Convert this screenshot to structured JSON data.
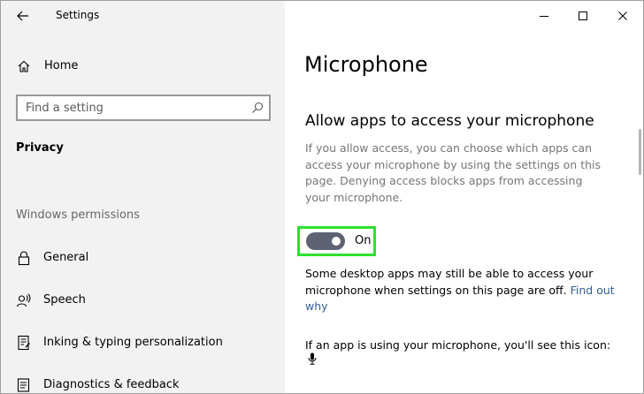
{
  "window": {
    "title": "Settings"
  },
  "sidebar": {
    "home_label": "Home",
    "search_placeholder": "Find a setting",
    "section": "Privacy",
    "group_label": "Windows permissions",
    "items": [
      {
        "label": "General",
        "icon": "lock-icon"
      },
      {
        "label": "Speech",
        "icon": "speech-icon"
      },
      {
        "label": "Inking & typing personalization",
        "icon": "inking-icon"
      },
      {
        "label": "Diagnostics & feedback",
        "icon": "diagnostics-icon"
      }
    ]
  },
  "main": {
    "page_title": "Microphone",
    "section_title": "Allow apps to access your microphone",
    "description": "If you allow access, you can choose which apps can access your microphone by using the settings on this page. Denying access blocks apps from accessing your microphone.",
    "toggle": {
      "state": "On",
      "checked": true
    },
    "note_text": "Some desktop apps may still be able to access your microphone when settings on this page are off.",
    "note_link": "Find out why",
    "icon_note": "If an app is using your microphone, you'll see this icon:"
  },
  "colors": {
    "sidebar_bg": "#f2f2f2",
    "toggle_on": "#5d6275",
    "highlight": "#2fe02f",
    "link": "#315e9e"
  }
}
